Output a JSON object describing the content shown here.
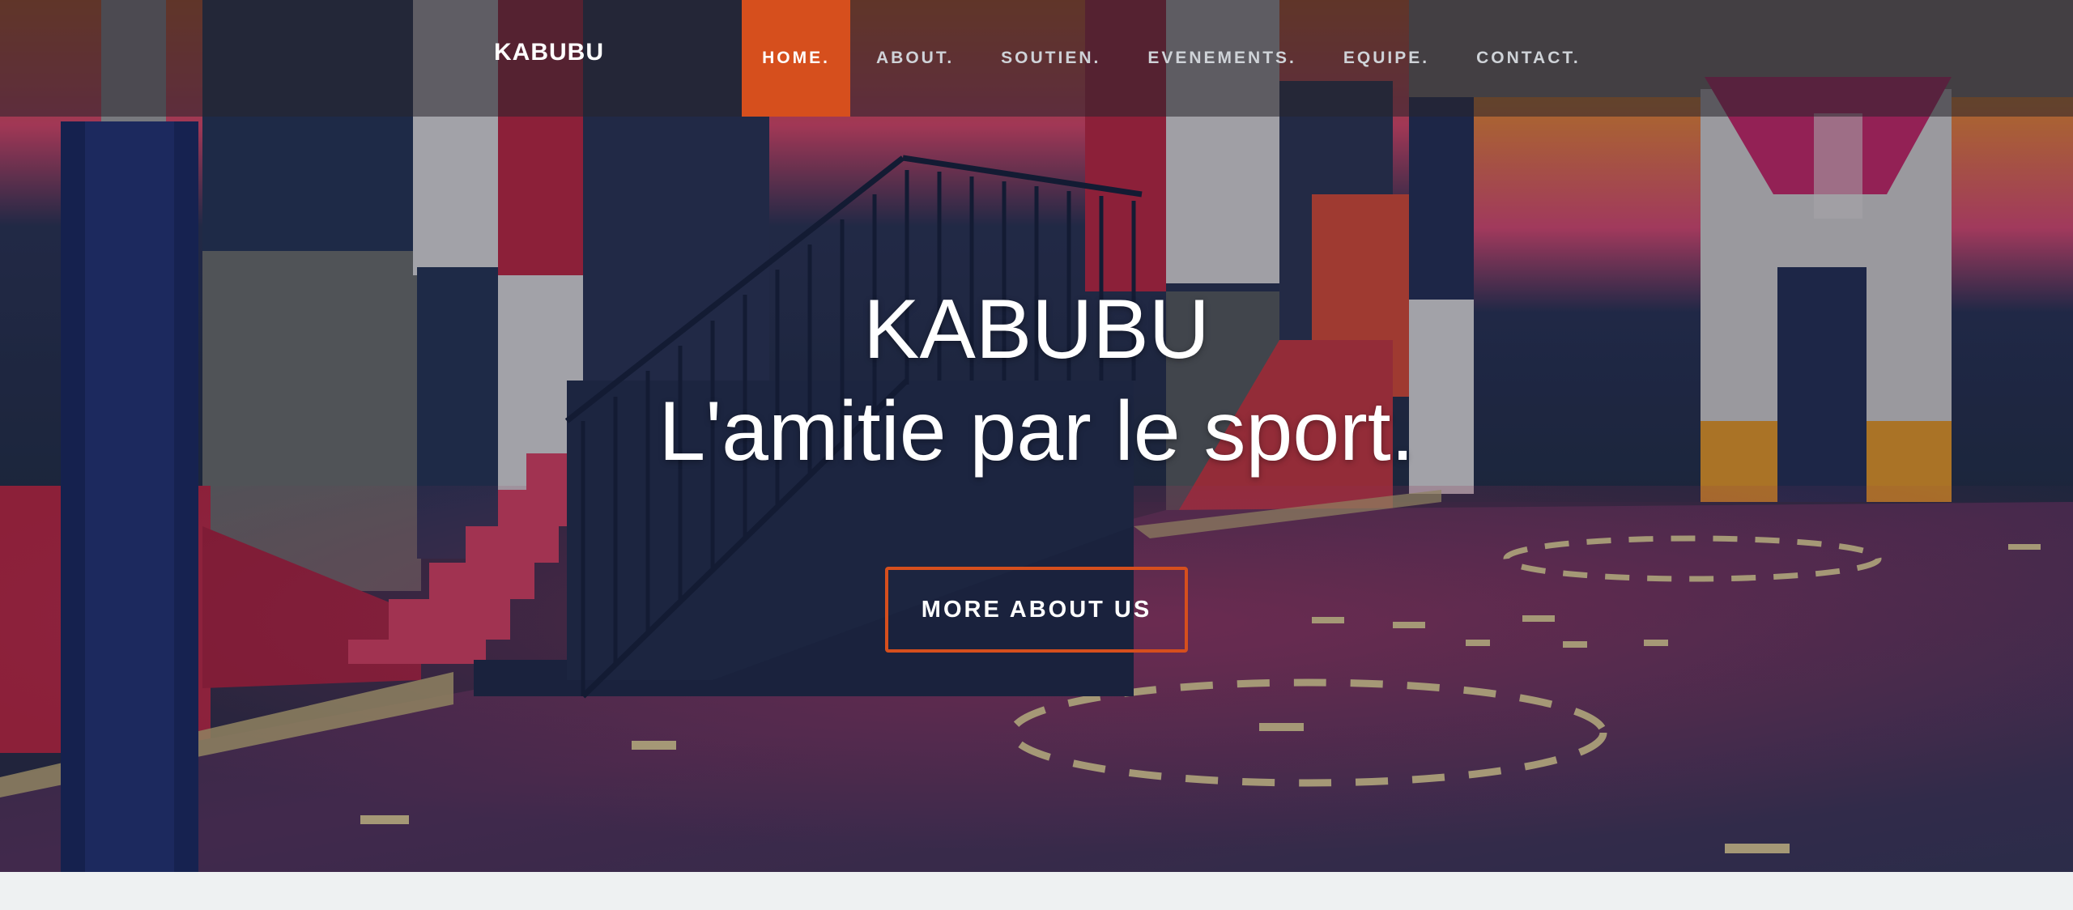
{
  "brand": {
    "name": "KABUBU"
  },
  "nav": {
    "items": [
      {
        "label": "HOME.",
        "active": true
      },
      {
        "label": "ABOUT."
      },
      {
        "label": "SOUTIEN."
      },
      {
        "label": "EVENEMENTS."
      },
      {
        "label": "EQUIPE."
      },
      {
        "label": "CONTACT."
      }
    ]
  },
  "hero": {
    "title": "KABUBU",
    "subtitle": "L'amitie par le sport.",
    "cta_label": "MORE ABOUT US"
  },
  "colors": {
    "accent": "#d64f1d",
    "navbar": "#28242c",
    "page_bg": "#eef1f2"
  }
}
